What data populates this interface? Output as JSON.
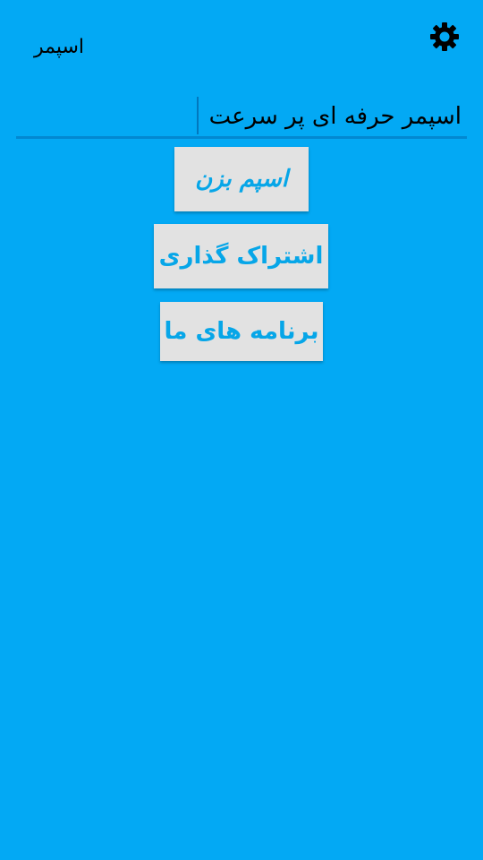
{
  "app": {
    "title": "اسپمر"
  },
  "toolbar": {
    "icons": [
      "moon-icon",
      "gear-icon"
    ]
  },
  "input": {
    "value": "اسپمر حرفه ای پر سرعت"
  },
  "buttons": {
    "spam_label": "اسپم بزن",
    "share_label": "اشتراک گذاری",
    "apps_label": "برنامه های ما"
  },
  "colors": {
    "background": "#03a9f4",
    "button_bg": "#e2e2e2",
    "button_text": "#06a6e8"
  }
}
